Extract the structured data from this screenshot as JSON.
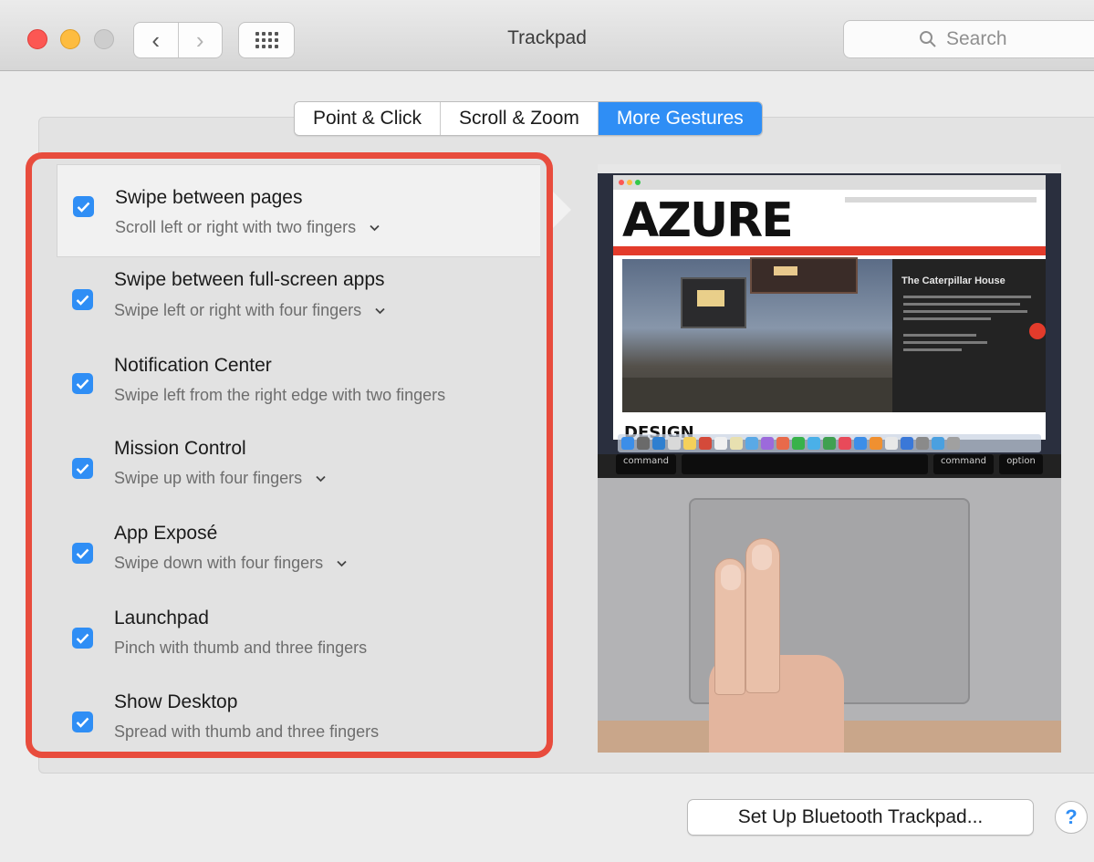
{
  "window": {
    "title": "Trackpad",
    "search_placeholder": "Search",
    "back_glyph": "‹",
    "forward_glyph": "›"
  },
  "tabs": [
    {
      "label": "Point & Click",
      "active": false
    },
    {
      "label": "Scroll & Zoom",
      "active": false
    },
    {
      "label": "More Gestures",
      "active": true
    }
  ],
  "gestures": [
    {
      "title": "Swipe between pages",
      "description": "Scroll left or right with two fingers",
      "checked": true,
      "has_menu": true
    },
    {
      "title": "Swipe between full-screen apps",
      "description": "Swipe left or right with four fingers",
      "checked": true,
      "has_menu": true
    },
    {
      "title": "Notification Center",
      "description": "Swipe left from the right edge with two fingers",
      "checked": true,
      "has_menu": false
    },
    {
      "title": "Mission Control",
      "description": "Swipe up with four fingers",
      "checked": true,
      "has_menu": true
    },
    {
      "title": "App Exposé",
      "description": "Swipe down with four fingers",
      "checked": true,
      "has_menu": true
    },
    {
      "title": "Launchpad",
      "description": "Pinch with thumb and three fingers",
      "checked": true,
      "has_menu": false
    },
    {
      "title": "Show Desktop",
      "description": "Spread with thumb and three fingers",
      "checked": true,
      "has_menu": false
    }
  ],
  "preview": {
    "site_logo": "AZURE",
    "article_title": "The Caterpillar House",
    "section_heading": "DESIGN",
    "keys": [
      "command",
      "command",
      "option"
    ]
  },
  "footer": {
    "bluetooth_button": "Set Up Bluetooth Trackpad...",
    "help_label": "?"
  },
  "colors": {
    "accent": "#2f8ef5",
    "highlight_border": "#e84c3d"
  }
}
